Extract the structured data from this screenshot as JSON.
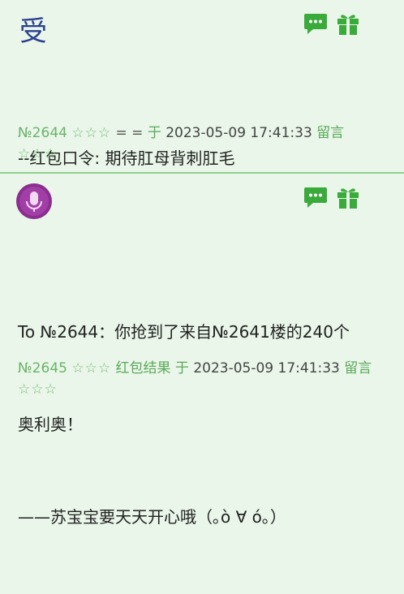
{
  "posts": [
    {
      "avatar_char": "受",
      "content_lines": [
        "--红包口令: 期待肛母背刺肛毛"
      ],
      "number": "№2644",
      "stars": "☆☆☆",
      "tag": "= =",
      "preposition": "于",
      "datetime": "2023-05-09 17:41:33",
      "reply_label": "留言",
      "stars2": "☆☆☆"
    },
    {
      "avatar_char": "",
      "content_lines": [
        "To №2644：你抢到了来自№2641楼的240个",
        "奥利奥！",
        "——苏宝宝要天天开心哦（｡ò ∀ ó｡）"
      ],
      "number": "№2645",
      "stars": "☆☆☆",
      "tag": "红包结果",
      "preposition": "于",
      "datetime": "2023-05-09 17:41:33",
      "reply_label": "留言",
      "stars2": "☆☆☆"
    }
  ],
  "icons": {
    "comment": "comment-icon",
    "gift": "gift-icon",
    "accent_color": "#3aaa3a"
  }
}
